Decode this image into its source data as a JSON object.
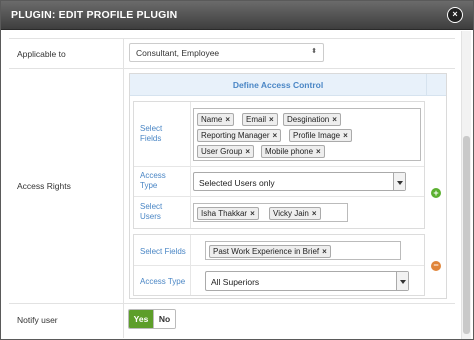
{
  "dialog": {
    "title": "PLUGIN: EDIT PROFILE PLUGIN",
    "close_icon": "×"
  },
  "applicable_to": {
    "label": "Applicable to",
    "value": "Consultant, Employee",
    "arrow": "⬍"
  },
  "access_rights": {
    "label": "Access Rights",
    "section_title": "Define Access Control",
    "group1": {
      "select_fields_label": "Select Fields",
      "fields": [
        "Name",
        "Email",
        "Desgination",
        "Reporting Manager",
        "Profile Image",
        "User Group",
        "Mobile phone"
      ],
      "access_type_label": "Access Type",
      "access_type_value": "Selected Users only",
      "select_users_label": "Select Users",
      "users": [
        "Isha Thakkar",
        "Vicky Jain"
      ]
    },
    "group2": {
      "select_fields_label": "Select Fields",
      "fields": [
        "Past Work Experience in Brief"
      ],
      "access_type_label": "Access Type",
      "access_type_value": "All Superiors"
    },
    "add_icon": "+",
    "remove_icon": "−"
  },
  "notify_user": {
    "label": "Notify user",
    "yes_label": "Yes",
    "no_label": "No",
    "selected": "Yes"
  },
  "tag_remove_glyph": "×",
  "colors": {
    "titlebar": "#4a4a4a",
    "accent_blue": "#4a86c5",
    "yes_green": "#5d9e2a",
    "add_green": "#5bb030",
    "remove_orange": "#e0853a"
  }
}
